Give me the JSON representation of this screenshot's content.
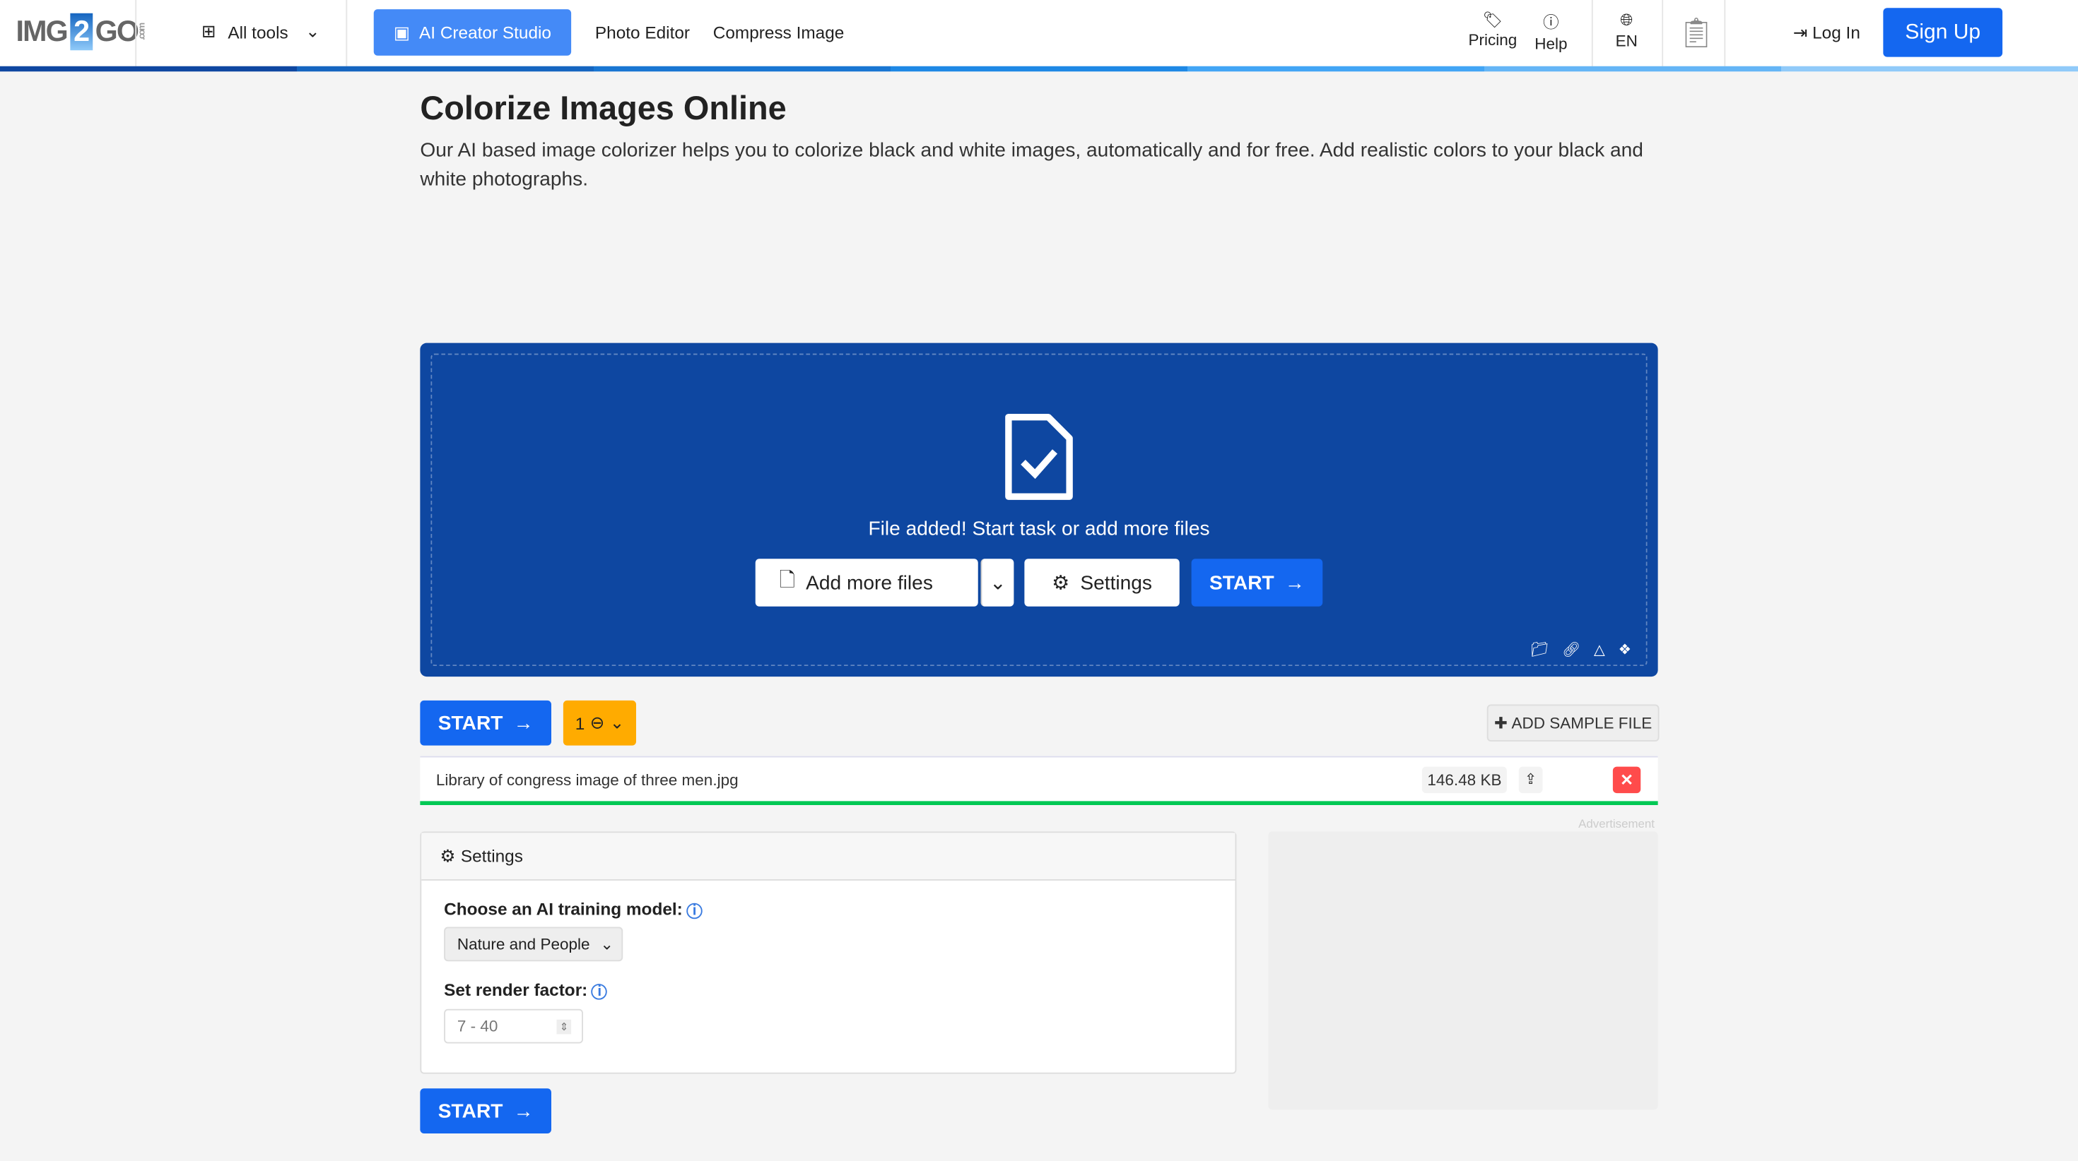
{
  "header": {
    "logo": "IMG2GO",
    "logo_left": "IMG",
    "logo_num": "2",
    "logo_right": "GO",
    "logo_suffix": ".com",
    "all_tools": "All tools",
    "ai_creator": "AI Creator Studio",
    "photo_editor": "Photo Editor",
    "compress": "Compress Image",
    "pricing": "Pricing",
    "help": "Help",
    "lang": "EN",
    "login": "Log In",
    "signup": "Sign Up"
  },
  "page": {
    "title": "Colorize Images Online",
    "description": "Our AI based image colorizer helps you to colorize black and white images, automatically and for free. Add realistic colors to your black and white photographs."
  },
  "dropzone": {
    "status": "File added! Start task or add more files",
    "add_more": "Add more files",
    "settings": "Settings",
    "start": "START"
  },
  "actions": {
    "start": "START",
    "credits": "1",
    "add_sample": "ADD SAMPLE FILE"
  },
  "file": {
    "name": "Library of congress image of three men.jpg",
    "size": "146.48 KB",
    "progress": 100
  },
  "settings": {
    "title": "Settings",
    "model_label": "Choose an AI training model:",
    "model_value": "Nature and People",
    "render_label": "Set render factor:",
    "render_placeholder": "7 - 40",
    "start": "START"
  },
  "ad": {
    "label": "Advertisement"
  },
  "colors": {
    "brand": "#1467f0",
    "dropzone": "#0e47a1",
    "credits": "#ffab00",
    "progress": "#00c853",
    "delete": "#ff4b4b"
  }
}
